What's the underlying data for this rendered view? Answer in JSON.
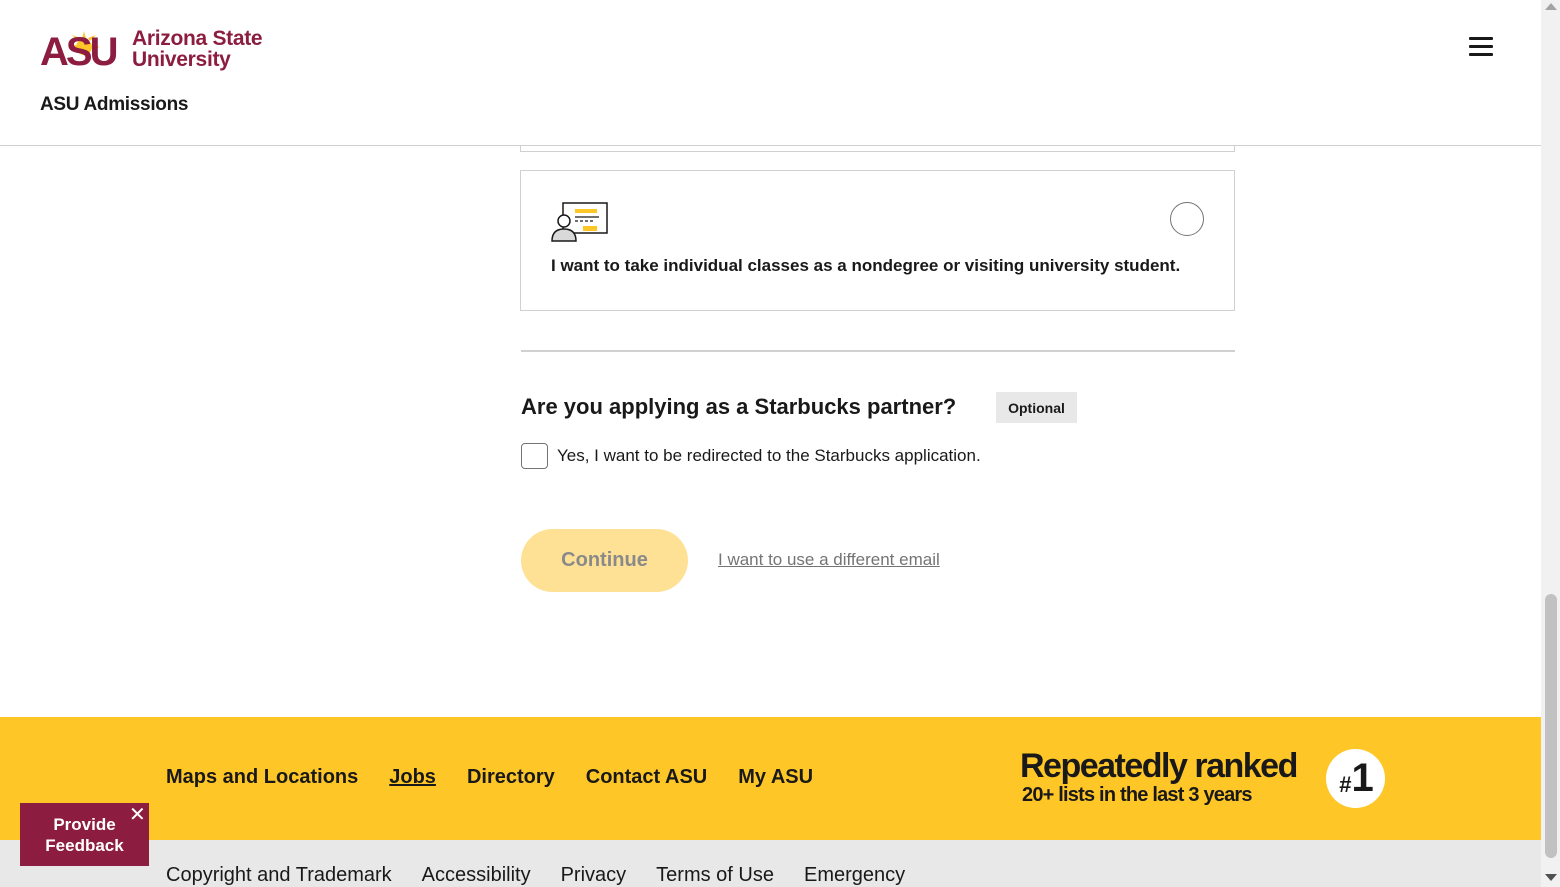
{
  "header": {
    "logo_text_line1": "Arizona State",
    "logo_text_line2": "University",
    "logo_mark": "ASU",
    "site_title": "ASU Admissions",
    "menu_icon": "hamburger-icon"
  },
  "colors": {
    "maroon": "#8c1d40",
    "gold": "#ffc627",
    "light_gold": "#ffe195",
    "gray_bg": "#e8e8e8"
  },
  "form": {
    "option_nondegree": {
      "icon": "student-id-card-icon",
      "label": "I want to take individual classes as a nondegree or visiting university student.",
      "selected": false
    },
    "starbucks": {
      "question": "Are you applying as a Starbucks partner?",
      "badge": "Optional",
      "checkbox_label": "Yes, I want to be redirected to the Starbucks application.",
      "checked": false
    },
    "continue_label": "Continue",
    "different_email_label": "I want to use a different email"
  },
  "footer": {
    "links": [
      "Maps and Locations",
      "Jobs",
      "Directory",
      "Contact ASU",
      "My ASU"
    ],
    "ranked_line1": "Repeatedly ranked",
    "ranked_line2": "20+ lists in the last 3 years",
    "ranked_badge_hash": "#",
    "ranked_badge_num": "1",
    "legal_links": [
      "Copyright and Trademark",
      "Accessibility",
      "Privacy",
      "Terms of Use",
      "Emergency"
    ]
  },
  "feedback": {
    "line1": "Provide",
    "line2": "Feedback",
    "close_icon": "close-icon"
  }
}
